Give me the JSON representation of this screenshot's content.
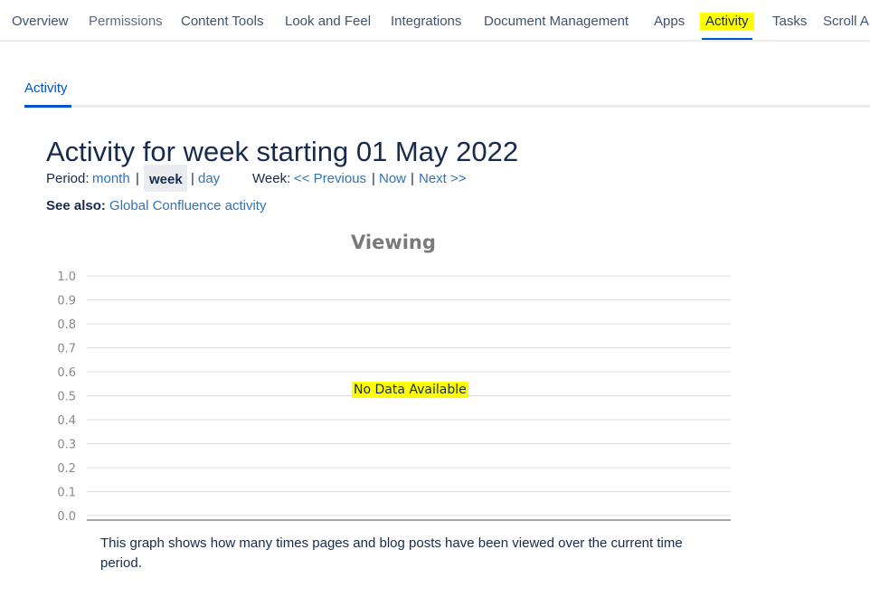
{
  "nav": {
    "tabs": [
      {
        "label": "Overview"
      },
      {
        "label": "Permissions"
      },
      {
        "label": "Content Tools"
      },
      {
        "label": "Look and Feel"
      },
      {
        "label": "Integrations"
      },
      {
        "label": "Document Management"
      },
      {
        "label": "Apps"
      },
      {
        "label": "Activity"
      },
      {
        "label": "Tasks"
      },
      {
        "label": "Scroll A"
      }
    ],
    "active_tab": "Activity"
  },
  "subtabs": {
    "activity": "Activity"
  },
  "page": {
    "title": "Activity for week starting 01 May 2022",
    "period_label": "Period:",
    "period_month": "month",
    "period_week": "week",
    "period_day": "day",
    "week_label": "Week:",
    "week_previous": "<< Previous",
    "week_now": "Now",
    "week_next": "Next >>",
    "separator": "|",
    "see_also_label": "See also:",
    "see_also_link": "Global Confluence activity",
    "caption": "This graph shows how many times pages and blog posts have been viewed over the current time period."
  },
  "chart_data": {
    "type": "line",
    "title": "Viewing",
    "y_ticks": [
      "1.0",
      "0.9",
      "0.8",
      "0.7",
      "0.6",
      "0.5",
      "0.4",
      "0.3",
      "0.2",
      "0.1",
      "0.0"
    ],
    "ylim": [
      0,
      1
    ],
    "series": [],
    "no_data_message": "No Data Available",
    "grid": true
  },
  "colors": {
    "link": "#3572b0",
    "highlight": "#ffff00",
    "accent": "#0052cc"
  }
}
